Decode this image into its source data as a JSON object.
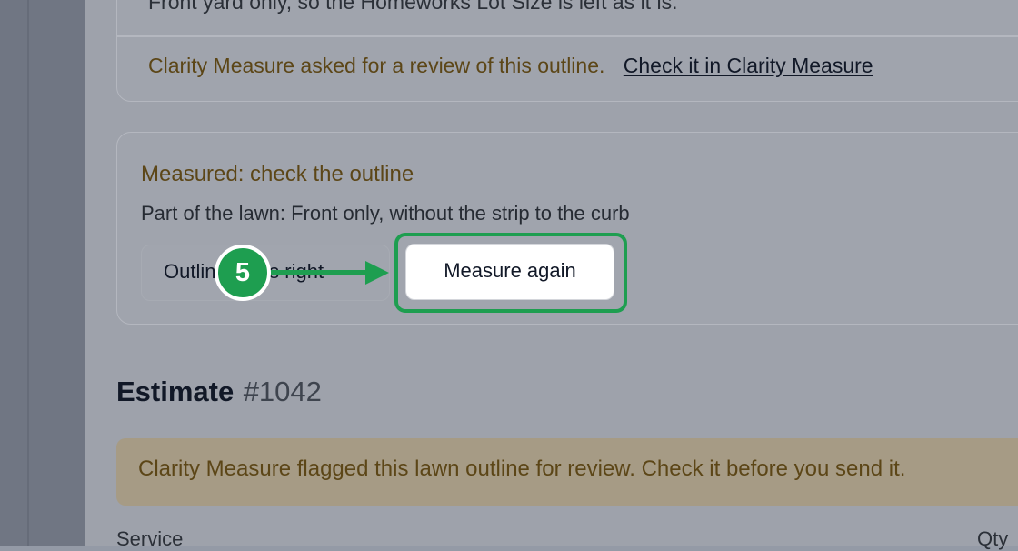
{
  "review_card": {
    "cut_text": "Front yard only, so the Homeworks Lot Size is left as it is.",
    "review_text": "Clarity Measure asked for a review of this outline.",
    "review_link": "Check it in Clarity Measure"
  },
  "measured_card": {
    "title": "Measured: check the outline",
    "subtitle": "Part of the lawn: Front only, without the strip to the curb",
    "buttons": {
      "outline_looks_right": "Outline looks right",
      "measure_again": "Measure again"
    }
  },
  "callout": {
    "step": "5",
    "color": "#1e9e50"
  },
  "estimate": {
    "label": "Estimate",
    "number": "#1042",
    "flag_text": "Clarity Measure flagged this lawn outline for review. Check it before you send it."
  },
  "table": {
    "columns": [
      "Service",
      "Qty"
    ]
  }
}
